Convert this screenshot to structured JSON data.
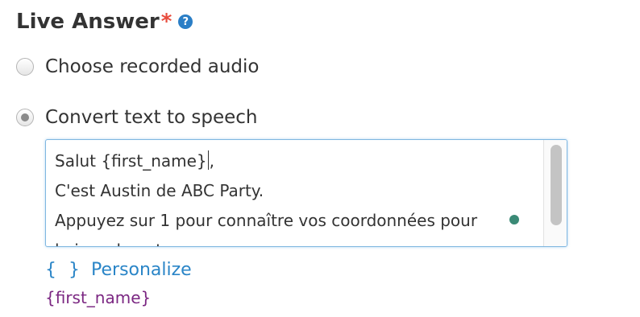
{
  "section": {
    "title": "Live Answer",
    "required_marker": "*",
    "help_icon": "?"
  },
  "options": [
    {
      "label": "Choose recorded audio",
      "selected": false
    },
    {
      "label": "Convert text to speech",
      "selected": true
    }
  ],
  "message": {
    "line1_before_cursor": "Salut {first_name}",
    "line1_after_cursor": ",",
    "line2": "C'est Austin de ABC Party.",
    "line3": "Appuyez sur 1 pour connaître vos coordonnées pour",
    "line4": "le jour du vote"
  },
  "personalize": {
    "icon": "{ }",
    "label": "Personalize"
  },
  "tokens": [
    "{first_name}"
  ]
}
